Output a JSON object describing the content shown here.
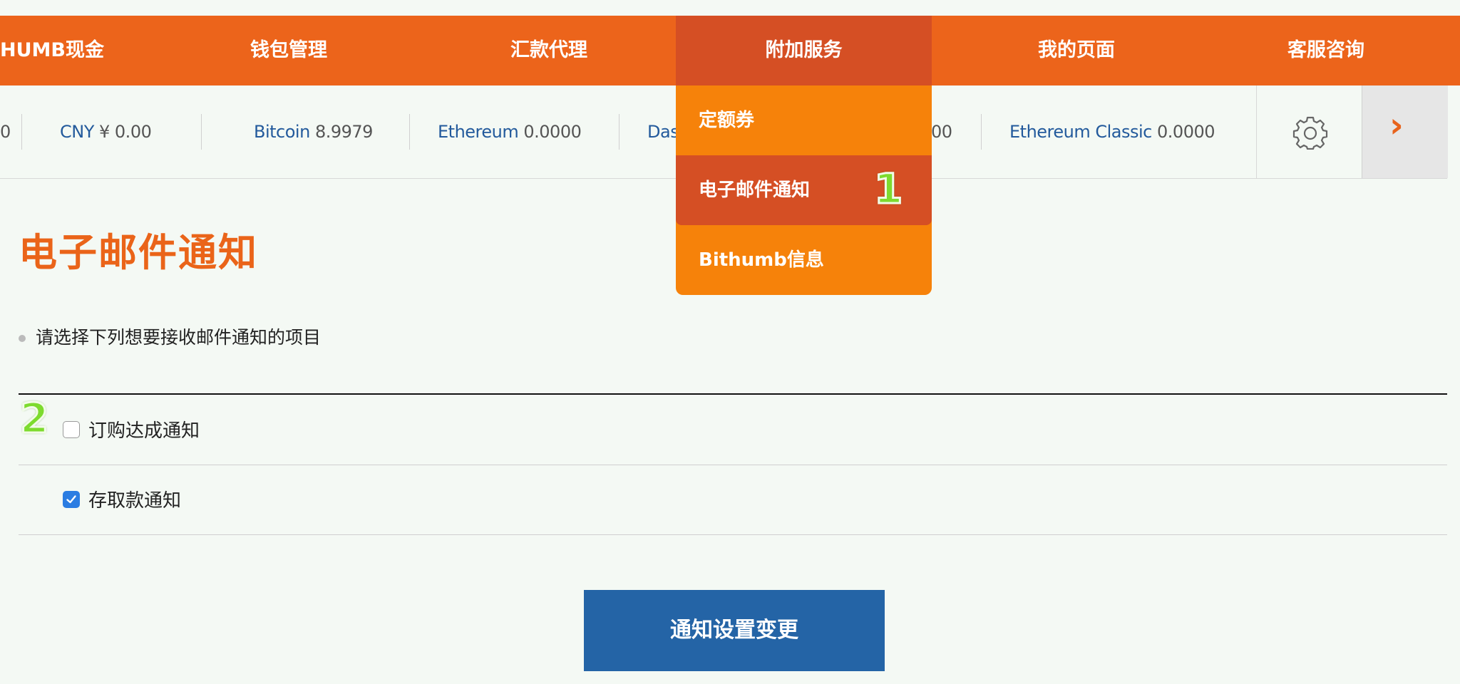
{
  "nav": {
    "items": [
      {
        "label": "HUMB现金"
      },
      {
        "label": "钱包管理"
      },
      {
        "label": "汇款代理"
      },
      {
        "label": "附加服务"
      },
      {
        "label": "我的页面"
      },
      {
        "label": "客服咨询"
      }
    ]
  },
  "ticker": {
    "left_partial": "0",
    "cny": {
      "name": "CNY",
      "value": "¥ 0.00"
    },
    "bitcoin": {
      "name": "Bitcoin",
      "value": "8.9979"
    },
    "ethereum": {
      "name": "Ethereum",
      "value": "0.0000"
    },
    "dash": {
      "name": "Das",
      "value": "00"
    },
    "etc": {
      "name": "Ethereum Classic",
      "value": "0.0000"
    },
    "settings_icon": "gear-icon",
    "next_icon": "chevron-right-icon"
  },
  "dropdown": {
    "items": [
      {
        "label": "定额券"
      },
      {
        "label": "电子邮件通知"
      },
      {
        "label": "Bithumb信息"
      }
    ],
    "badge": "1"
  },
  "content": {
    "title": "电子邮件通知",
    "instruction": "请选择下列想要接收邮件通知的项目",
    "options": [
      {
        "label": "订购达成通知",
        "checked": false
      },
      {
        "label": "存取款通知",
        "checked": true
      }
    ],
    "badge": "2",
    "submit_label": "通知设置变更"
  },
  "colors": {
    "nav": "#ec641b",
    "nav_active": "#d54f24",
    "dropdown": "#f6820a",
    "title": "#ea6419",
    "button": "#2464a6",
    "checkbox_checked": "#2b7de2",
    "badge": "#7ddb2e"
  }
}
